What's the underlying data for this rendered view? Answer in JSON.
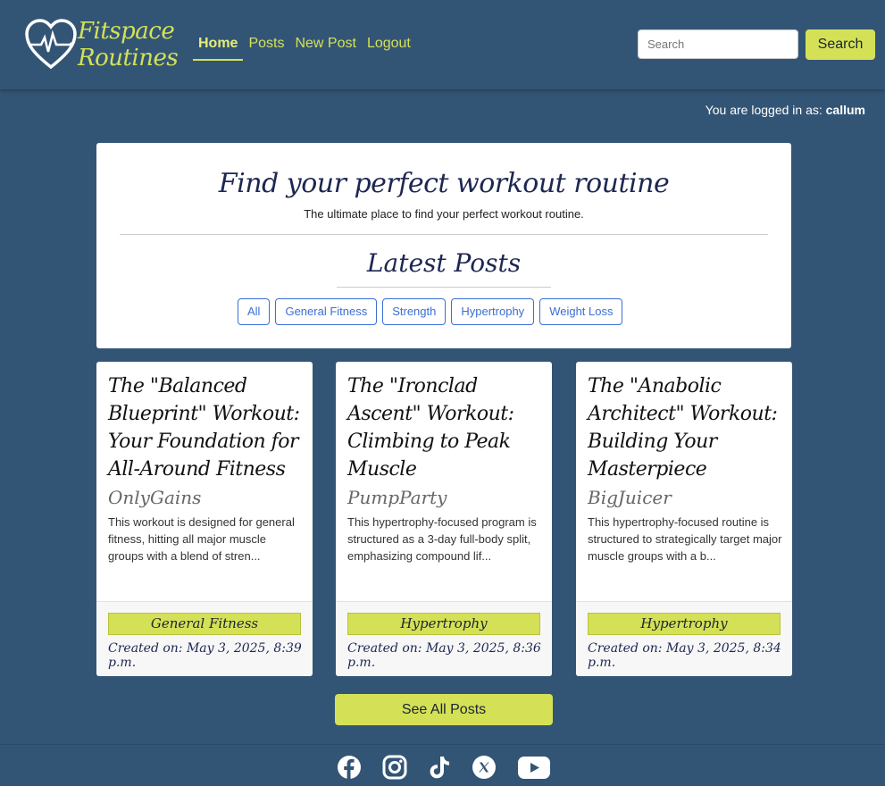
{
  "brand": {
    "line1": "Fitspace",
    "line2": "Routines"
  },
  "nav": {
    "items": [
      {
        "label": "Home",
        "active": true
      },
      {
        "label": "Posts",
        "active": false
      },
      {
        "label": "New Post",
        "active": false
      },
      {
        "label": "Logout",
        "active": false
      }
    ]
  },
  "search": {
    "placeholder": "Search",
    "button_label": "Search"
  },
  "user": {
    "prefix": "You are logged in as:",
    "username": "callum"
  },
  "hero": {
    "title": "Find your perfect workout routine",
    "subtitle": "The ultimate place to find your perfect workout routine.",
    "latest_title": "Latest Posts",
    "filters": [
      "All",
      "General Fitness",
      "Strength",
      "Hypertrophy",
      "Weight Loss"
    ]
  },
  "posts": [
    {
      "title": "The \"Balanced Blueprint\" Workout: Your Foundation for All-Around Fitness",
      "author": "OnlyGains",
      "excerpt": "This workout is designed for general fitness, hitting all major muscle groups with a blend of stren...",
      "tag": "General Fitness",
      "created": "Created on: May 3, 2025, 8:39 p.m."
    },
    {
      "title": "The \"Ironclad Ascent\" Workout: Climbing to Peak Muscle",
      "author": "PumpParty",
      "excerpt": "This hypertrophy-focused program is structured as a 3-day full-body split, emphasizing compound lif...",
      "tag": "Hypertrophy",
      "created": "Created on: May 3, 2025, 8:36 p.m."
    },
    {
      "title": "The \"Anabolic Architect\" Workout: Building Your Masterpiece",
      "author": "BigJuicer",
      "excerpt": "This hypertrophy-focused routine is structured to strategically target major muscle groups with a b...",
      "tag": "Hypertrophy",
      "created": "Created on: May 3, 2025, 8:34 p.m."
    }
  ],
  "see_all_label": "See All Posts",
  "colors": {
    "background": "#335575",
    "accent": "#d4e157",
    "link_blue": "#3b6fd4"
  },
  "social_icons": [
    "facebook-icon",
    "instagram-icon",
    "tiktok-icon",
    "x-icon",
    "youtube-icon"
  ]
}
